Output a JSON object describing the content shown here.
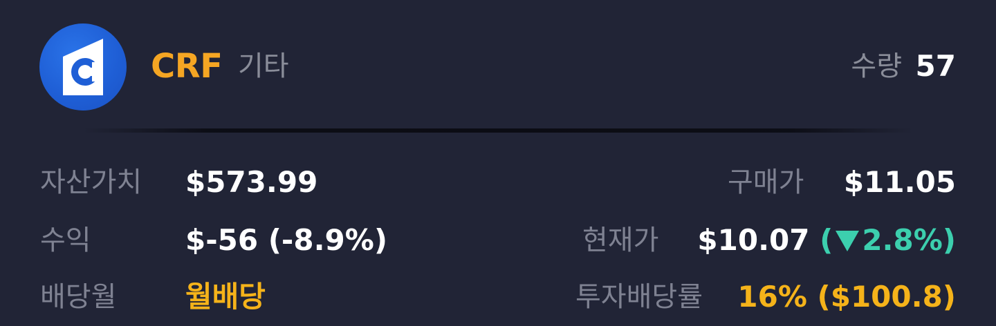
{
  "header": {
    "ticker": "CRF",
    "category": "기타",
    "qty_label": "수량",
    "qty_value": "57",
    "logo_icon": "crf-logo-icon",
    "logo_color": "#1f5fd6"
  },
  "stats": {
    "asset_value_label": "자산가치",
    "asset_value": "$573.99",
    "purchase_price_label": "구매가",
    "purchase_price": "$11.05",
    "profit_label": "수익",
    "profit_value": "$-56 (-8.9%)",
    "current_price_label": "현재가",
    "current_price": "$10.07",
    "change_open": "(",
    "change_direction_icon": "down-triangle-icon",
    "change_percent": "2.8%",
    "change_close": ")",
    "dividend_month_label": "배당월",
    "dividend_month_value": "월배당",
    "dividend_yield_label": "투자배당률",
    "dividend_yield_value": "16% ($100.8)"
  },
  "colors": {
    "background": "#212436",
    "accent_orange": "#f5a623",
    "positive_teal": "#3ccfae",
    "muted_label": "#7f8292"
  }
}
